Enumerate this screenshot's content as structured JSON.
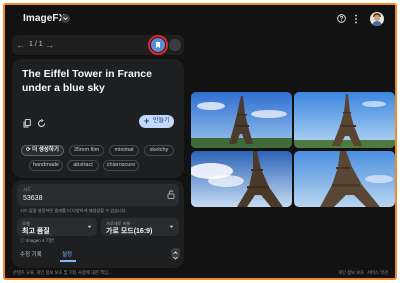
{
  "app": {
    "title": "ImageFX"
  },
  "nav": {
    "counter": "1 / 1"
  },
  "prompt": {
    "text": "The Eiffel Tower in France under a blue sky"
  },
  "create_button": {
    "label": "만들기"
  },
  "chips": {
    "more_label": "더 생성하기",
    "items": [
      "35mm film",
      "minimal",
      "sketchy",
      "handmade",
      "abstract",
      "chiaroscuro"
    ]
  },
  "settings": {
    "seed_label": "시드",
    "seed_value": "53638",
    "seed_help": "시드 값을 설정하면 결과를 더 다양하게 재생성할 수 있습니다.",
    "model_label": "모델",
    "model_value": "최고 품질",
    "ratio_label": "가로세로 비율",
    "ratio_value": "가로 모드(16:9)",
    "model_tag": "Imagen 4 기반",
    "tabs": [
      "수정 기록",
      "설정"
    ],
    "active_tab": "설정"
  },
  "footer": {
    "disclaimer": "콘텐츠 오류, 개인 정보 보호 및 기타 사항에 대한 책임...",
    "link_privacy": "개인 정보 보호",
    "link_terms": "서비스 약관"
  },
  "colors": {
    "accent": "#8ab4f8",
    "highlight_border": "#e0262a",
    "frame_border": "#f08a24"
  },
  "images": [
    {
      "alt": "Eiffel Tower under blue sky 1"
    },
    {
      "alt": "Eiffel Tower under blue sky 2"
    },
    {
      "alt": "Eiffel Tower under blue sky 3"
    },
    {
      "alt": "Eiffel Tower under blue sky 4"
    }
  ]
}
